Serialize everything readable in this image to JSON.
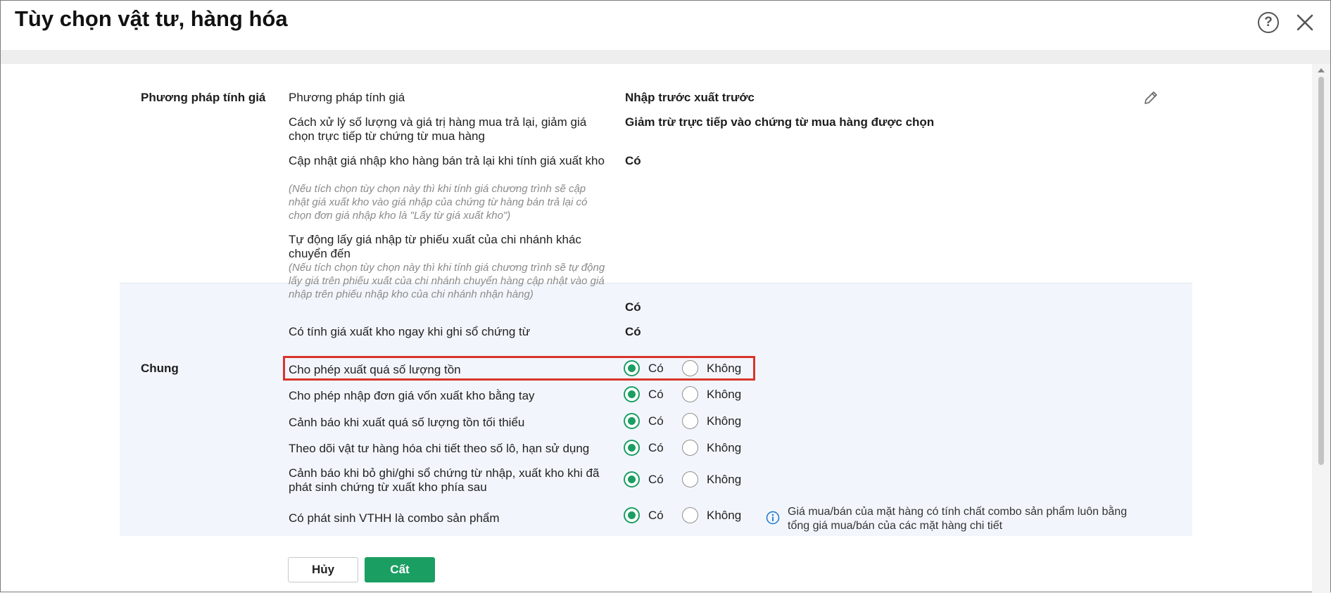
{
  "window": {
    "title": "Tùy chọn vật tư, hàng hóa"
  },
  "pricing": {
    "section_label": "Phương pháp tính giá",
    "rows": [
      {
        "label": "Phương pháp tính giá",
        "value": "Nhập trước xuất trước"
      },
      {
        "label": "Cách xử lý số lượng và giá trị hàng mua trả lại, giảm giá chọn trực tiếp từ chứng từ mua hàng",
        "value": "Giảm trừ trực tiếp vào chứng từ mua hàng được chọn"
      },
      {
        "label": "Cập nhật giá nhập kho hàng bán trả lại khi tính giá xuất kho",
        "note": "(Nếu tích chọn tùy chọn này thì khi tính giá chương trình sẽ cập nhật giá xuất kho vào giá nhập của chứng từ hàng bán trả lại có chọn đơn giá nhập kho là \"Lấy từ giá xuất kho\")",
        "value": "Có"
      },
      {
        "label": "Tự động lấy giá nhập từ phiếu xuất của chi nhánh khác chuyển đến",
        "note": "(Nếu tích chọn tùy chọn này thì khi tính giá chương trình sẽ tự động lấy giá trên phiếu xuất của chi nhánh chuyển hàng cập nhật vào giá nhập trên phiếu nhập kho của chi nhánh nhận hàng)",
        "value": "Có"
      },
      {
        "label": "Có tính giá xuất kho ngay khi ghi sổ chứng từ",
        "value": "Có"
      }
    ]
  },
  "general": {
    "section_label": "Chung",
    "yes_label": "Có",
    "no_label": "Không",
    "rows": [
      {
        "label": "Cho phép xuất quá số lượng tồn",
        "selected": "yes"
      },
      {
        "label": "Cho phép nhập đơn giá vốn xuất kho bằng tay",
        "selected": "yes"
      },
      {
        "label": "Cảnh báo khi xuất quá số lượng tồn tối thiểu",
        "selected": "yes"
      },
      {
        "label": "Theo dõi vật tư hàng hóa chi tiết theo số lô, hạn sử dụng",
        "selected": "yes"
      },
      {
        "label": "Cảnh báo khi bỏ ghi/ghi sổ chứng từ nhập, xuất kho khi đã phát sinh chứng từ xuất kho phía sau",
        "selected": "yes"
      },
      {
        "label": "Có phát sinh VTHH là combo sản phẩm",
        "selected": "yes"
      }
    ],
    "combo_info": "Giá mua/bán của mặt hàng có tính chất combo sản phẩm luôn bằng tổng giá mua/bán của các mặt hàng chi tiết"
  },
  "actions": {
    "cancel_label": "Hủy",
    "save_label": "Cất"
  },
  "colors": {
    "accent": "#1b9e62",
    "highlight": "#d9342b",
    "info": "#1976d2"
  }
}
